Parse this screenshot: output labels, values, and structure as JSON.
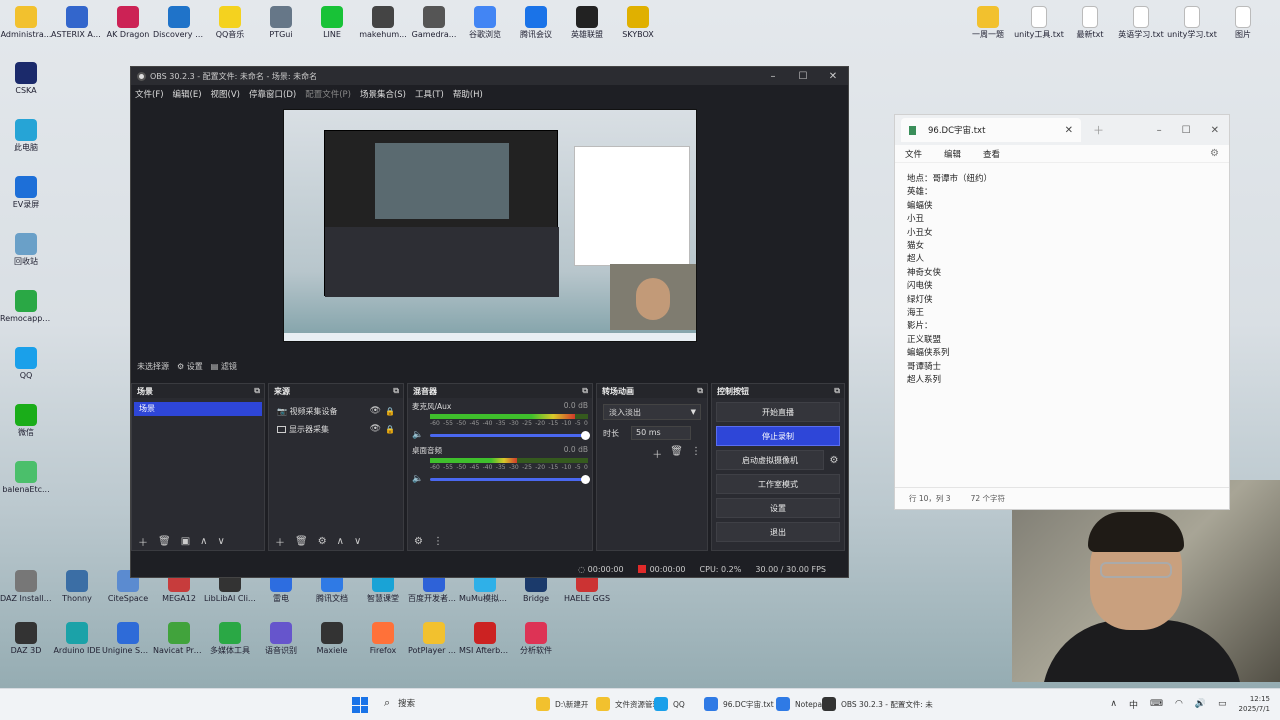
{
  "desktop": {
    "left_icons": [
      {
        "label": "Administra...",
        "color": "#f2c12e"
      },
      {
        "label": "ASTERIX Analyzer",
        "color": "#3366cc"
      },
      {
        "label": "AK Dragon",
        "color": "#cc2255"
      },
      {
        "label": "Discovery Studio 20...",
        "color": "#1f73c9"
      },
      {
        "label": "QQ音乐",
        "color": "#f4d21f"
      },
      {
        "label": "PTGui",
        "color": "#667788"
      },
      {
        "label": "LINE",
        "color": "#18c237"
      },
      {
        "label": "makehum...",
        "color": "#444444"
      },
      {
        "label": "Gamedra...",
        "color": "#555555"
      },
      {
        "label": "谷歌浏览",
        "color": "#4285f4"
      },
      {
        "label": "腾讯会议",
        "color": "#1a73e8"
      },
      {
        "label": "英雄联盟",
        "color": "#222222"
      },
      {
        "label": "SKYBOX",
        "color": "#e0b000"
      }
    ],
    "col_icons": [
      {
        "label": "CSKA",
        "color": "#1b2a6b"
      },
      {
        "label": "此电脑",
        "color": "#26a4d6"
      },
      {
        "label": "EV录屏",
        "color": "#1d6fd8"
      },
      {
        "label": "回收站",
        "color": "#6aa0c8"
      },
      {
        "label": "Remocapp 2.1.1",
        "color": "#2aa845"
      },
      {
        "label": "QQ",
        "color": "#1aa0ea"
      },
      {
        "label": "微信",
        "color": "#1aad19"
      },
      {
        "label": "balenaEtc...",
        "color": "#4bbf6b"
      }
    ],
    "bottom_icons": [
      {
        "label": "DAZ Install Manager...",
        "color": "#777777"
      },
      {
        "label": "Thonny",
        "color": "#3b6ea5"
      },
      {
        "label": "CiteSpace",
        "color": "#5b8bd0"
      },
      {
        "label": "MEGA12",
        "color": "#c73c3c"
      },
      {
        "label": "LibLibAI Client",
        "color": "#333333"
      },
      {
        "label": "雷电",
        "color": "#2d6de0"
      },
      {
        "label": "腾讯文档",
        "color": "#2f7ae5"
      },
      {
        "label": "智慧课堂",
        "color": "#19a3d6"
      },
      {
        "label": "百度开发者工具",
        "color": "#2e62d8"
      },
      {
        "label": "MuMu模拟器12",
        "color": "#2fb0e8"
      },
      {
        "label": "Bridge",
        "color": "#1b3a6b"
      },
      {
        "label": "HAELE GGS",
        "color": "#cc3333"
      },
      {
        "label": "DAZ 3D",
        "color": "#333333"
      },
      {
        "label": "Arduino IDE",
        "color": "#1ba2a8"
      },
      {
        "label": "Unigine SDK Browser 2",
        "color": "#2e6bd8"
      },
      {
        "label": "Navicat Premium",
        "color": "#41a33c"
      },
      {
        "label": "多媒体工具",
        "color": "#2aa845"
      },
      {
        "label": "语音识别",
        "color": "#6655cc"
      },
      {
        "label": "Maxiele",
        "color": "#333333"
      },
      {
        "label": "Firefox",
        "color": "#ff7139"
      },
      {
        "label": "PotPlayer 64 bit",
        "color": "#f2c12e"
      },
      {
        "label": "MSI Afterburner",
        "color": "#cc2222"
      },
      {
        "label": "分析软件",
        "color": "#dd3355"
      }
    ],
    "right_icons": [
      {
        "label": "一周一题",
        "color": "#f2c12e"
      },
      {
        "label": "unity工具.txt",
        "color": "#ffffff"
      },
      {
        "label": "最新txt",
        "color": "#ffffff"
      },
      {
        "label": "英语学习.txt",
        "color": "#ffffff"
      },
      {
        "label": "unity学习.txt",
        "color": "#ffffff"
      },
      {
        "label": "图片",
        "color": "#ffffff"
      }
    ]
  },
  "obs": {
    "title": "OBS 30.2.3 - 配置文件: 未命名 - 场景: 未命名",
    "menu": [
      "文件(F)",
      "编辑(E)",
      "视图(V)",
      "停靠窗口(D)",
      "配置文件(P)",
      "场景集合(S)",
      "工具(T)",
      "帮助(H)"
    ],
    "scene_toolbar": {
      "current_scene": "未选择源",
      "properties": "设置",
      "filters": "滤镜"
    },
    "docks": {
      "scenes": {
        "title": "场景",
        "items": [
          "场景"
        ]
      },
      "sources": {
        "title": "来源",
        "items": [
          "视频采集设备",
          "显示器采集"
        ]
      },
      "mixer": {
        "title": "混音器",
        "channels": [
          {
            "name": "麦克风/Aux",
            "db": "0.0 dB",
            "level": 0.92
          },
          {
            "name": "桌面音频",
            "db": "0.0 dB",
            "level": 0.55
          }
        ],
        "ticks": [
          "-60",
          "-55",
          "-50",
          "-45",
          "-40",
          "-35",
          "-30",
          "-25",
          "-20",
          "-15",
          "-10",
          "-5",
          "0"
        ]
      },
      "transitions": {
        "title": "转场动画",
        "selected": "淡入淡出",
        "duration_label": "时长",
        "duration_value": "50 ms"
      },
      "controls": {
        "title": "控制按钮",
        "start_streaming": "开始直播",
        "stop_recording": "停止录制",
        "start_virtual_camera": "启动虚拟摄像机",
        "studio_mode": "工作室模式",
        "settings": "设置",
        "exit": "退出"
      }
    },
    "status": {
      "stream_time": "00:00:00",
      "rec_time": "00:00:00",
      "cpu": "CPU: 0.2%",
      "fps": "30.00 / 30.00 FPS"
    }
  },
  "notepad": {
    "tab_title": "96.DC宇宙.txt",
    "menu": [
      "文件",
      "编辑",
      "查看"
    ],
    "lines": [
      "地点：哥谭市（纽约）",
      "英雄：",
      "蝙蝠侠",
      "小丑",
      "小丑女",
      "猫女",
      "超人",
      "神奇女侠",
      "闪电侠",
      "绿灯侠",
      "海王",
      "影片：",
      "正义联盟",
      "蝙蝠侠系列",
      "哥谭骑士",
      "超人系列"
    ],
    "status_pos": "行 10，列 3",
    "status_chars": "72 个字符"
  },
  "taskbar": {
    "search": "搜索",
    "apps": [
      {
        "label": "D:\\新建开",
        "color": "#f2c12e"
      },
      {
        "label": "文件资源管理",
        "color": "#f2c12e"
      },
      {
        "label": "QQ",
        "color": "#1aa0ea"
      },
      {
        "label": "96.DC宇宙.txt",
        "color": "#2f7ae5"
      },
      {
        "label": "Notepad",
        "color": "#2f7ae5"
      },
      {
        "label": "OBS 30.2.3 - 配置文件: 未",
        "color": "#333333"
      }
    ],
    "time": "12:15",
    "date": "2025/7/1"
  }
}
